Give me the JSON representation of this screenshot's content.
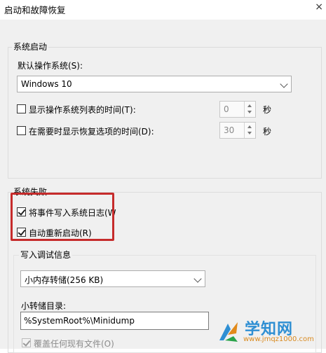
{
  "window": {
    "title": "启动和故障恢复",
    "close": "×"
  },
  "system_startup": {
    "group_label": "系统启动",
    "default_os_label": "默认操作系统(S):",
    "default_os_value": "Windows 10",
    "show_os_list": {
      "label": "显示操作系统列表的时间(T):",
      "checked": false,
      "value": "0",
      "unit": "秒"
    },
    "show_recovery": {
      "label": "在需要时显示恢复选项的时间(D):",
      "checked": false,
      "value": "30",
      "unit": "秒"
    }
  },
  "system_failure": {
    "group_label": "系统失败",
    "write_event": {
      "label": "将事件写入系统日志(W",
      "checked": true
    },
    "auto_restart": {
      "label": "自动重新启动(R)",
      "checked": true
    }
  },
  "debug_info": {
    "group_label": "写入调试信息",
    "dump_type": "小内存转储(256 KB)",
    "dump_dir_label": "小转储目录:",
    "dump_dir_value": "%SystemRoot%\\Minidump",
    "overwrite": {
      "label": "覆盖任何现有文件(O)",
      "checked": true,
      "disabled": true
    }
  },
  "watermark": {
    "main": "学知网",
    "sub": "www.jmqz1000.com"
  },
  "colors": {
    "highlight": "#c62b2b",
    "watermark_blue": "#2f8fd3",
    "watermark_orange": "#d98a1f"
  }
}
